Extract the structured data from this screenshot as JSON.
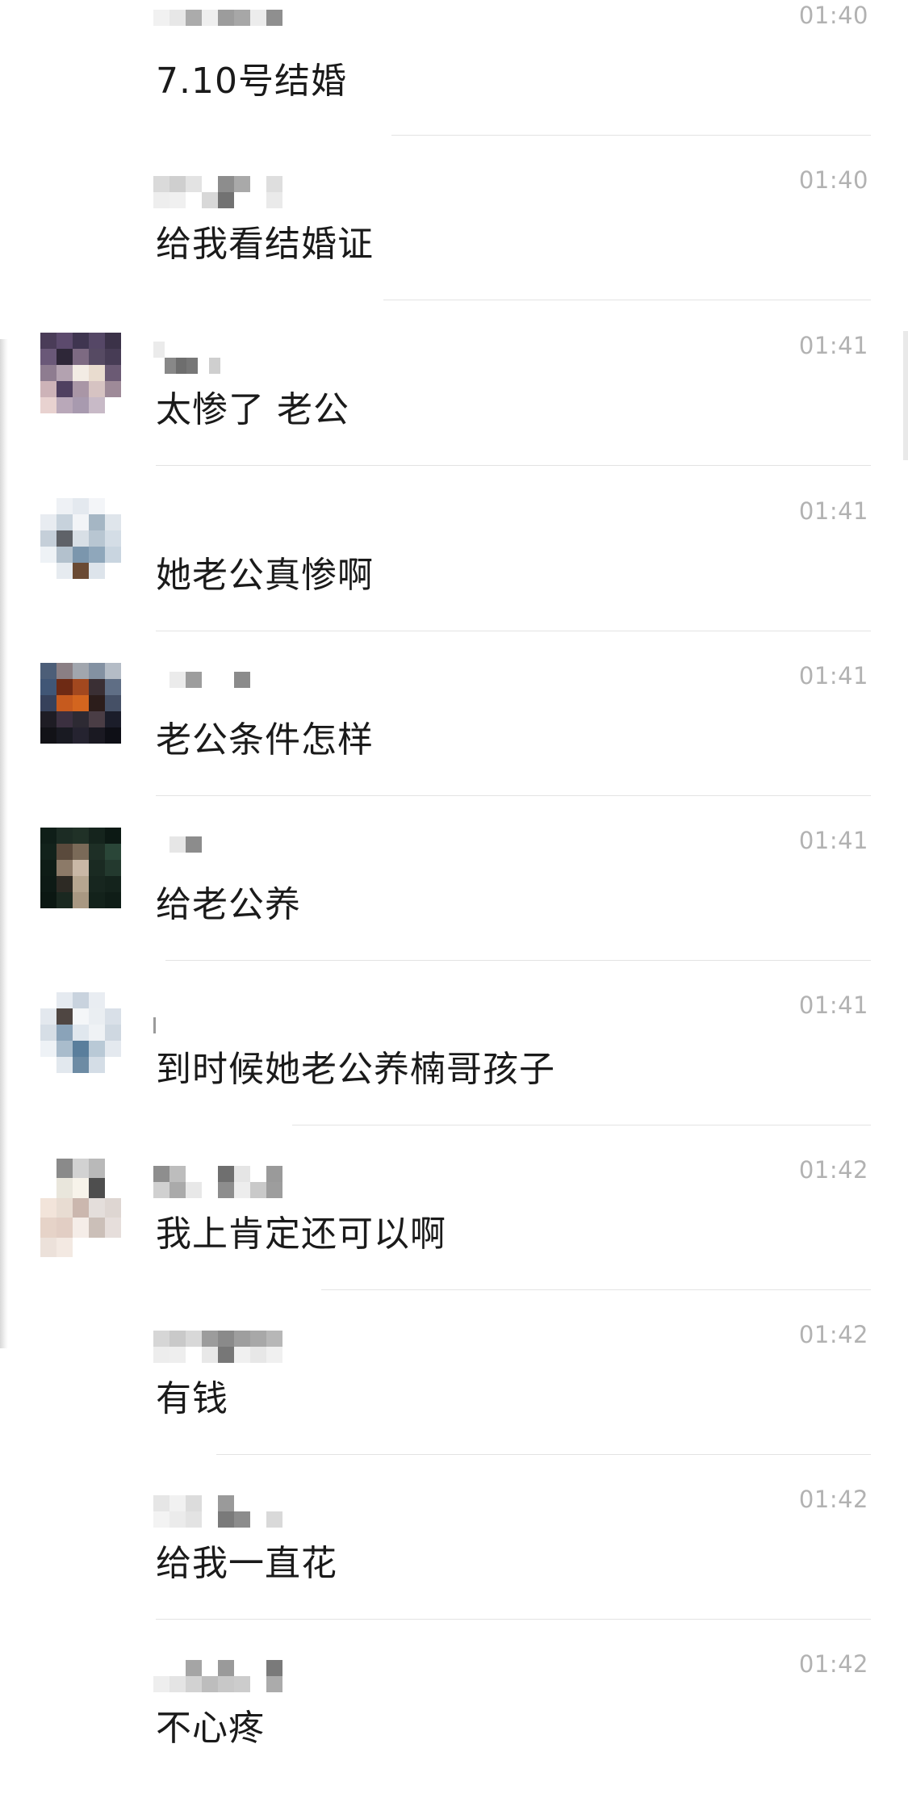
{
  "messages": [
    {
      "time": "01:40",
      "text": "7.10号结婚",
      "avatar": null
    },
    {
      "time": "01:40",
      "text": "给我看结婚证",
      "avatar": null
    },
    {
      "time": "01:41",
      "text": "太惨了 老公",
      "avatar": "dark-purple"
    },
    {
      "time": "01:41",
      "text": "她老公真惨啊",
      "avatar": "light-blue"
    },
    {
      "time": "01:41",
      "text": "老公条件怎样",
      "avatar": "orange-dark"
    },
    {
      "time": "01:41",
      "text": "给老公养",
      "avatar": "dark-green"
    },
    {
      "time": "01:41",
      "text": "到时候她老公养楠哥孩子",
      "avatar": "light-blue-2"
    },
    {
      "time": "01:42",
      "text": "我上肯定还可以啊",
      "avatar": "beige-gray"
    },
    {
      "time": "01:42",
      "text": "有钱",
      "avatar": null
    },
    {
      "time": "01:42",
      "text": "给我一直花",
      "avatar": null
    },
    {
      "time": "01:42",
      "text": "不心疼",
      "avatar": null
    }
  ],
  "colors": {
    "time": "#b2b2b2",
    "text": "#1a1a1a",
    "divider": "#e3e3e3"
  }
}
